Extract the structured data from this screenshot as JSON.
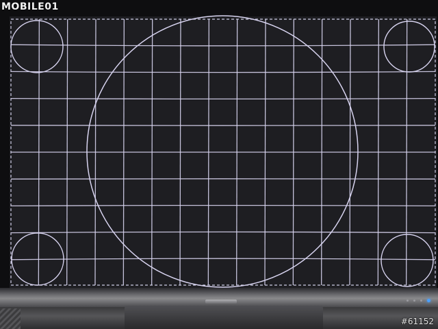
{
  "photo": {
    "subject": "",
    "watermark_logo": "MOBILE01",
    "watermark_id": "#61152"
  },
  "colors": {
    "screen_background": "#1e1e22",
    "grid_line": "#d8d4f0",
    "border_dash": "#cfcde6",
    "bezel": "#0e0e10",
    "power_led": "#4aa0ff",
    "watermark_text": "#f2f2f2"
  },
  "icons": [
    "mobile01-logo-icon",
    "power-led-icon"
  ],
  "test_pattern": {
    "grid_columns": 15,
    "grid_rows": 10,
    "circles": [
      "center-circle",
      "corner-circle-top-left",
      "corner-circle-top-right",
      "corner-circle-bottom-left",
      "corner-circle-bottom-right"
    ],
    "dashed_border": true
  }
}
